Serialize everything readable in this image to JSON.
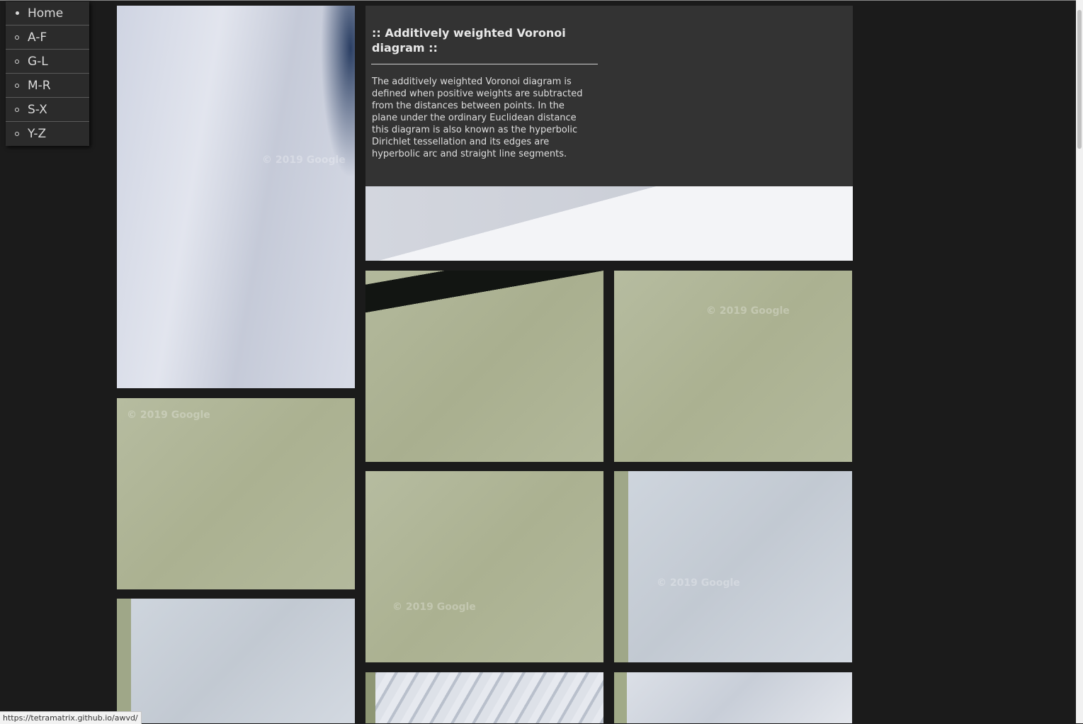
{
  "nav": {
    "items": [
      {
        "label": "Home",
        "bullet": "filled"
      },
      {
        "label": "A-F",
        "bullet": "open"
      },
      {
        "label": "G-L",
        "bullet": "open"
      },
      {
        "label": "M-R",
        "bullet": "open"
      },
      {
        "label": "S-X",
        "bullet": "open"
      },
      {
        "label": "Y-Z",
        "bullet": "open"
      }
    ]
  },
  "info": {
    "title": ":: Additively weighted Voronoi diagram ::",
    "description": "The additively weighted Voronoi diagram is defined when positive weights are subtracted from the distances between points. In the plane under the ordinary Euclidean distance this diagram is also known as the hyperbolic Dirichlet tessellation and its edges are hyperbolic arc and straight line segments."
  },
  "tiles": {
    "watermark": "© 2019 Google"
  },
  "status": {
    "url": "https://tetramatrix.github.io/awvd/"
  }
}
